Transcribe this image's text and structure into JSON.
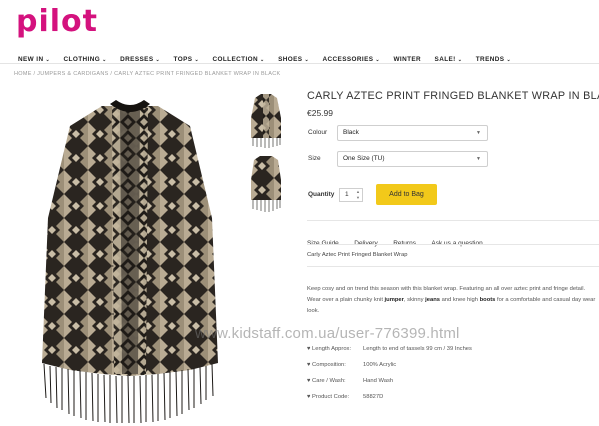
{
  "brand": {
    "logo": "pilot"
  },
  "nav": [
    {
      "label": "NEW IN",
      "chevron": true
    },
    {
      "label": "CLOTHING",
      "chevron": true
    },
    {
      "label": "DRESSES",
      "chevron": true
    },
    {
      "label": "TOPS",
      "chevron": true
    },
    {
      "label": "COLLECTION",
      "chevron": true
    },
    {
      "label": "SHOES",
      "chevron": true
    },
    {
      "label": "ACCESSORIES",
      "chevron": true
    },
    {
      "label": "WINTER",
      "chevron": false
    },
    {
      "label": "SALE!",
      "chevron": true
    },
    {
      "label": "TRENDS",
      "chevron": true
    }
  ],
  "breadcrumb": "HOME / JUMPERS & CARDIGANS / CARLY AZTEC PRINT FRINGED BLANKET WRAP IN BLACK",
  "product": {
    "title": "CARLY AZTEC PRINT FRINGED BLANKET WRAP IN BLACK",
    "price": "€25.99",
    "colour_label": "Colour",
    "colour_value": "Black",
    "size_label": "Size",
    "size_value": "One Size (TU)",
    "quantity_label": "Quantity",
    "quantity_value": "1",
    "add_to_bag": "Add to Bag"
  },
  "tabs": [
    "Size Guide",
    "Delivery",
    "Returns",
    "Ask us a question"
  ],
  "tab_subtitle": "Carly Aztec Print Fringed Blanket Wrap",
  "description": {
    "part1": "Keep cosy and on trend this season with this blanket wrap. Featuring an all over aztec print and fringe detail. Wear over a plain chunky knit ",
    "jumper": "jumper",
    "part2": ", skinny ",
    "jeans": "jeans",
    "part3": " and knee high ",
    "boots": "boots",
    "part4": " for a comfortable and casual day wear look."
  },
  "specs": [
    {
      "key": "♥ Length Approx:",
      "value": "Length to end of tassels 99 cm / 39 Inches"
    },
    {
      "key": "♥ Composition:",
      "value": "100% Acrylic"
    },
    {
      "key": "♥ Care / Wash:",
      "value": "Hand Wash"
    },
    {
      "key": "♥ Product Code:",
      "value": "58827D"
    }
  ],
  "watermark": "www.kidstaff.com.ua/user-776399.html",
  "colors": {
    "brand_pink": "#d4127e",
    "button_yellow": "#f2c91a"
  }
}
